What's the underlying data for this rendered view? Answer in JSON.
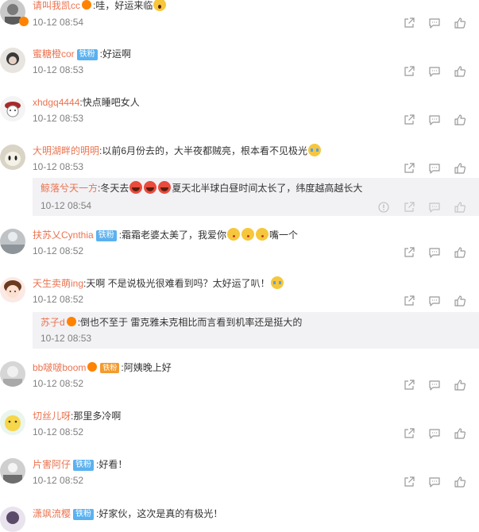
{
  "comments": [
    {
      "user": "请叫我凯cc",
      "badge": "",
      "text": ":哇，好运来临",
      "time": "10-12 08:54"
    },
    {
      "user": "蜜糖橙cor",
      "badge": "铁粉",
      "text": ":好运啊",
      "time": "10-12 08:53"
    },
    {
      "user": "xhdgq4444",
      "badge": "",
      "text": ":快点睡吧女人",
      "time": "10-12 08:53"
    },
    {
      "user": "大明湖畔的明明",
      "badge": "",
      "text": ":以前6月份去的，大半夜都贼亮，根本看不见极光",
      "time": "10-12 08:53",
      "reply": {
        "user": "鲸落兮天一方",
        "text_a": ":冬天去",
        "text_b": "夏天北半球白昼时间太长了，纬度越高越长大",
        "time": "10-12 08:54"
      }
    },
    {
      "user": "扶苏乂Cynthia",
      "badge": "铁粉",
      "text_a": ":霜霜老婆太美了，我爱你",
      "text_b": "嘴一个",
      "time": "10-12 08:52"
    },
    {
      "user": "天生卖萌ing",
      "badge": "",
      "text": ":天啊 不是说极光很难看到吗？太好运了叭！",
      "time": "10-12 08:52",
      "reply": {
        "user": "苏子d",
        "text": ":倒也不至于 雷克雅未克相比而言看到机率还是挺大的",
        "time": "10-12 08:53"
      }
    },
    {
      "user": "bb啵啵boom",
      "badge": "铁粉",
      "text": ":阿姨晚上好",
      "time": "10-12 08:52"
    },
    {
      "user": "切丝儿呀",
      "badge": "",
      "text": ":那里多冷啊",
      "time": "10-12 08:52"
    },
    {
      "user": "片害阿仔",
      "badge": "铁粉",
      "text": ":好看！",
      "time": "10-12 08:52"
    },
    {
      "user": "潇飒流樱",
      "badge": "铁粉",
      "text": ":好家伙，这次是真的有极光！",
      "time": ""
    }
  ],
  "icons": {
    "share": "share-icon",
    "comment": "comment-icon",
    "like": "like-icon",
    "report": "report-icon"
  },
  "colors": {
    "username": "#eb7350",
    "badge": "#5ab1f0",
    "time": "#808080",
    "reply_bg": "#f2f2f5"
  }
}
